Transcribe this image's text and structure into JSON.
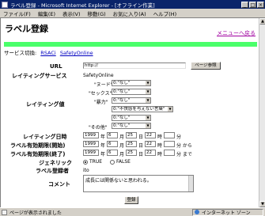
{
  "window": {
    "title": "ラベル登録 - Microsoft Internet Explorer - [オフライン作業]",
    "minimize": "_",
    "maximize": "□",
    "close": "×"
  },
  "menu": [
    "ファイル(F)",
    "編集(E)",
    "表示(V)",
    "移動(G)",
    "お気に入り(A)",
    "ヘルプ(H)"
  ],
  "page": {
    "title": "ラベル登録",
    "back_link": "メニューへ戻る",
    "service_label": "サービス切換:",
    "services": [
      "RSACi",
      "SafetyOnline"
    ]
  },
  "form": {
    "url_label": "URL",
    "url_value": "http://",
    "url_button": "ページ参照",
    "service_label": "レイティングサービス",
    "service_value": "SafetyOnline",
    "rating_label": "レイティング値",
    "categories": [
      {
        "name": "\"ヌード\"",
        "value": "0:\"なし\""
      },
      {
        "name": "\"セックス\"",
        "value": "0:\"なし\""
      },
      {
        "name": "\"暴力\"",
        "value": "0:\"なし\""
      },
      {
        "name": "",
        "value": "0:\"不快感を与えない言葉\""
      },
      {
        "name": "",
        "value": "0:\"なし\""
      },
      {
        "name": "\"その他\"",
        "value": "0:\"なし\""
      }
    ],
    "date_rows": [
      {
        "label": "レイティング日時",
        "year": "1999",
        "month": "6",
        "day": "25",
        "hour": "22",
        "minute": "",
        "suffix": "分"
      },
      {
        "label": "ラベル有効期限(開始)",
        "year": "1999",
        "month": "6",
        "day": "25",
        "hour": "22",
        "minute": "",
        "suffix": "分 から"
      },
      {
        "label": "ラベル有効期限(終了)",
        "year": "1999",
        "month": "6",
        "day": "25",
        "hour": "22",
        "minute": "",
        "suffix": "分 まで"
      }
    ],
    "units": {
      "year": "年",
      "month": "月",
      "day": "日",
      "hour": "時"
    },
    "generic_label": "ジェネリック",
    "generic_true": "TRUE",
    "generic_false": "FALSE",
    "registrant_label": "ラベル登録者",
    "registrant_value": "ito",
    "comment_label": "コメント",
    "comment_value": "成長には関係ないと思われる。",
    "submit": "登録"
  },
  "status": {
    "text": "ページが表示されました",
    "zone": "インターネット ゾーン"
  }
}
